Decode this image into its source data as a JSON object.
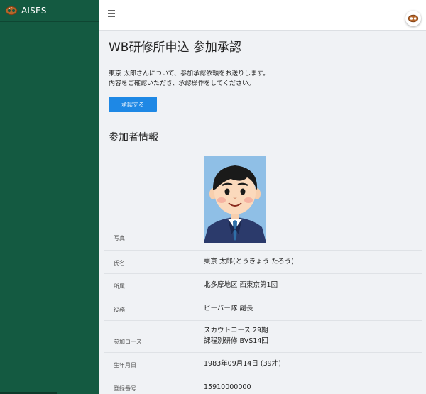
{
  "app": {
    "name": "AISES"
  },
  "header": {
    "menu_icon": "hamburger-icon",
    "avatar_icon": "pretzel-avatar-icon"
  },
  "page": {
    "title": "WB研修所申込 参加承認",
    "message_line1": "東京 太郎さんについて、参加承認依頼をお送りします。",
    "message_line2": "内容をご確認いただき、承認操作をしてください。",
    "approve_label": "承認する",
    "section_title": "参加者情報"
  },
  "participant": {
    "photo": {
      "label": "写真",
      "image": "portrait-photo"
    },
    "name": {
      "label": "氏名",
      "value": "東京 太郎(とうきょう たろう)"
    },
    "affiliation": {
      "label": "所属",
      "value": "北多摩地区 西東京第1団"
    },
    "role": {
      "label": "役務",
      "value": "ビーバー隊 副長"
    },
    "course": {
      "label": "参加コース",
      "value_line1": "スカウトコース 29期",
      "value_line2": "課程別研修 BVS14回"
    },
    "birthdate": {
      "label": "生年月日",
      "value": "1983年09月14日 (39才)"
    },
    "registration": {
      "label": "登録番号",
      "value": "15910000000"
    }
  },
  "colors": {
    "sidebar": "#145a41",
    "button": "#1e88e5",
    "background": "#f0f2f5"
  }
}
